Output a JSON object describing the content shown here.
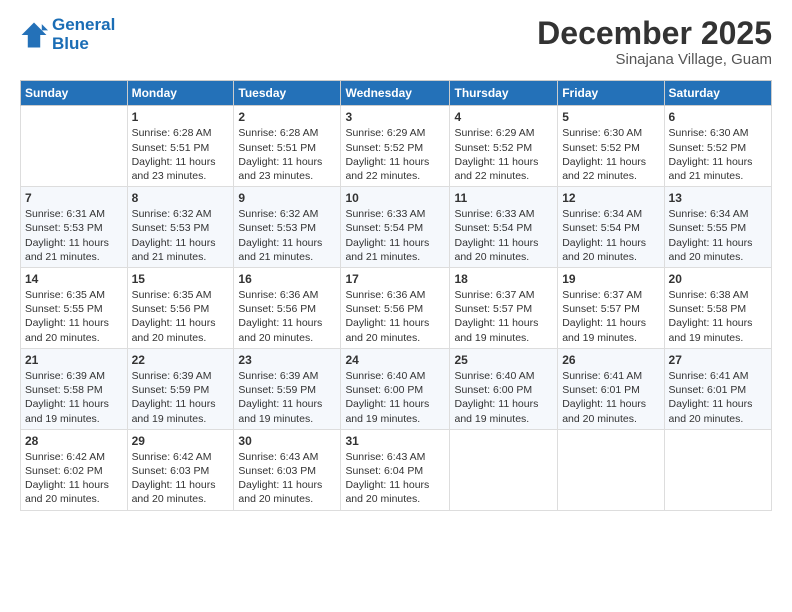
{
  "header": {
    "logo_line1": "General",
    "logo_line2": "Blue",
    "month": "December 2025",
    "location": "Sinajana Village, Guam"
  },
  "weekdays": [
    "Sunday",
    "Monday",
    "Tuesday",
    "Wednesday",
    "Thursday",
    "Friday",
    "Saturday"
  ],
  "weeks": [
    [
      {
        "day": "",
        "sunrise": "",
        "sunset": "",
        "daylight": ""
      },
      {
        "day": "1",
        "sunrise": "Sunrise: 6:28 AM",
        "sunset": "Sunset: 5:51 PM",
        "daylight": "Daylight: 11 hours and 23 minutes."
      },
      {
        "day": "2",
        "sunrise": "Sunrise: 6:28 AM",
        "sunset": "Sunset: 5:51 PM",
        "daylight": "Daylight: 11 hours and 23 minutes."
      },
      {
        "day": "3",
        "sunrise": "Sunrise: 6:29 AM",
        "sunset": "Sunset: 5:52 PM",
        "daylight": "Daylight: 11 hours and 22 minutes."
      },
      {
        "day": "4",
        "sunrise": "Sunrise: 6:29 AM",
        "sunset": "Sunset: 5:52 PM",
        "daylight": "Daylight: 11 hours and 22 minutes."
      },
      {
        "day": "5",
        "sunrise": "Sunrise: 6:30 AM",
        "sunset": "Sunset: 5:52 PM",
        "daylight": "Daylight: 11 hours and 22 minutes."
      },
      {
        "day": "6",
        "sunrise": "Sunrise: 6:30 AM",
        "sunset": "Sunset: 5:52 PM",
        "daylight": "Daylight: 11 hours and 21 minutes."
      }
    ],
    [
      {
        "day": "7",
        "sunrise": "Sunrise: 6:31 AM",
        "sunset": "Sunset: 5:53 PM",
        "daylight": "Daylight: 11 hours and 21 minutes."
      },
      {
        "day": "8",
        "sunrise": "Sunrise: 6:32 AM",
        "sunset": "Sunset: 5:53 PM",
        "daylight": "Daylight: 11 hours and 21 minutes."
      },
      {
        "day": "9",
        "sunrise": "Sunrise: 6:32 AM",
        "sunset": "Sunset: 5:53 PM",
        "daylight": "Daylight: 11 hours and 21 minutes."
      },
      {
        "day": "10",
        "sunrise": "Sunrise: 6:33 AM",
        "sunset": "Sunset: 5:54 PM",
        "daylight": "Daylight: 11 hours and 21 minutes."
      },
      {
        "day": "11",
        "sunrise": "Sunrise: 6:33 AM",
        "sunset": "Sunset: 5:54 PM",
        "daylight": "Daylight: 11 hours and 20 minutes."
      },
      {
        "day": "12",
        "sunrise": "Sunrise: 6:34 AM",
        "sunset": "Sunset: 5:54 PM",
        "daylight": "Daylight: 11 hours and 20 minutes."
      },
      {
        "day": "13",
        "sunrise": "Sunrise: 6:34 AM",
        "sunset": "Sunset: 5:55 PM",
        "daylight": "Daylight: 11 hours and 20 minutes."
      }
    ],
    [
      {
        "day": "14",
        "sunrise": "Sunrise: 6:35 AM",
        "sunset": "Sunset: 5:55 PM",
        "daylight": "Daylight: 11 hours and 20 minutes."
      },
      {
        "day": "15",
        "sunrise": "Sunrise: 6:35 AM",
        "sunset": "Sunset: 5:56 PM",
        "daylight": "Daylight: 11 hours and 20 minutes."
      },
      {
        "day": "16",
        "sunrise": "Sunrise: 6:36 AM",
        "sunset": "Sunset: 5:56 PM",
        "daylight": "Daylight: 11 hours and 20 minutes."
      },
      {
        "day": "17",
        "sunrise": "Sunrise: 6:36 AM",
        "sunset": "Sunset: 5:56 PM",
        "daylight": "Daylight: 11 hours and 20 minutes."
      },
      {
        "day": "18",
        "sunrise": "Sunrise: 6:37 AM",
        "sunset": "Sunset: 5:57 PM",
        "daylight": "Daylight: 11 hours and 19 minutes."
      },
      {
        "day": "19",
        "sunrise": "Sunrise: 6:37 AM",
        "sunset": "Sunset: 5:57 PM",
        "daylight": "Daylight: 11 hours and 19 minutes."
      },
      {
        "day": "20",
        "sunrise": "Sunrise: 6:38 AM",
        "sunset": "Sunset: 5:58 PM",
        "daylight": "Daylight: 11 hours and 19 minutes."
      }
    ],
    [
      {
        "day": "21",
        "sunrise": "Sunrise: 6:39 AM",
        "sunset": "Sunset: 5:58 PM",
        "daylight": "Daylight: 11 hours and 19 minutes."
      },
      {
        "day": "22",
        "sunrise": "Sunrise: 6:39 AM",
        "sunset": "Sunset: 5:59 PM",
        "daylight": "Daylight: 11 hours and 19 minutes."
      },
      {
        "day": "23",
        "sunrise": "Sunrise: 6:39 AM",
        "sunset": "Sunset: 5:59 PM",
        "daylight": "Daylight: 11 hours and 19 minutes."
      },
      {
        "day": "24",
        "sunrise": "Sunrise: 6:40 AM",
        "sunset": "Sunset: 6:00 PM",
        "daylight": "Daylight: 11 hours and 19 minutes."
      },
      {
        "day": "25",
        "sunrise": "Sunrise: 6:40 AM",
        "sunset": "Sunset: 6:00 PM",
        "daylight": "Daylight: 11 hours and 19 minutes."
      },
      {
        "day": "26",
        "sunrise": "Sunrise: 6:41 AM",
        "sunset": "Sunset: 6:01 PM",
        "daylight": "Daylight: 11 hours and 20 minutes."
      },
      {
        "day": "27",
        "sunrise": "Sunrise: 6:41 AM",
        "sunset": "Sunset: 6:01 PM",
        "daylight": "Daylight: 11 hours and 20 minutes."
      }
    ],
    [
      {
        "day": "28",
        "sunrise": "Sunrise: 6:42 AM",
        "sunset": "Sunset: 6:02 PM",
        "daylight": "Daylight: 11 hours and 20 minutes."
      },
      {
        "day": "29",
        "sunrise": "Sunrise: 6:42 AM",
        "sunset": "Sunset: 6:03 PM",
        "daylight": "Daylight: 11 hours and 20 minutes."
      },
      {
        "day": "30",
        "sunrise": "Sunrise: 6:43 AM",
        "sunset": "Sunset: 6:03 PM",
        "daylight": "Daylight: 11 hours and 20 minutes."
      },
      {
        "day": "31",
        "sunrise": "Sunrise: 6:43 AM",
        "sunset": "Sunset: 6:04 PM",
        "daylight": "Daylight: 11 hours and 20 minutes."
      },
      {
        "day": "",
        "sunrise": "",
        "sunset": "",
        "daylight": ""
      },
      {
        "day": "",
        "sunrise": "",
        "sunset": "",
        "daylight": ""
      },
      {
        "day": "",
        "sunrise": "",
        "sunset": "",
        "daylight": ""
      }
    ]
  ]
}
